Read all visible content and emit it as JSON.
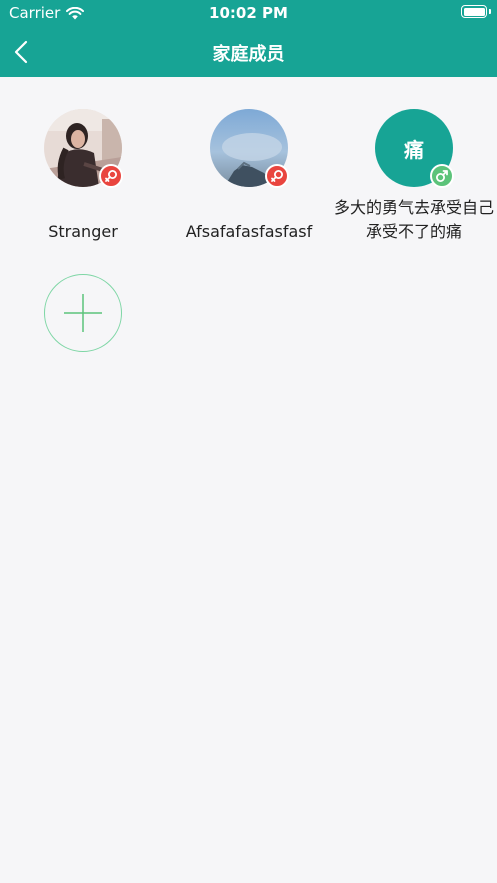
{
  "status_bar": {
    "carrier": "Carrier",
    "time": "10:02 PM"
  },
  "nav": {
    "title": "家庭成员"
  },
  "members": [
    {
      "name": "Stranger",
      "gender": "female"
    },
    {
      "name": "Afsafafasfasfasf",
      "gender": "female"
    },
    {
      "name": "多大的勇气去承受自己承受不了的痛",
      "avatar_text": "痛",
      "gender": "male"
    }
  ],
  "colors": {
    "header": "#17a495",
    "female_badge": "#e9453f",
    "male_badge": "#5cc37a",
    "add_border": "#7ed6a5"
  }
}
